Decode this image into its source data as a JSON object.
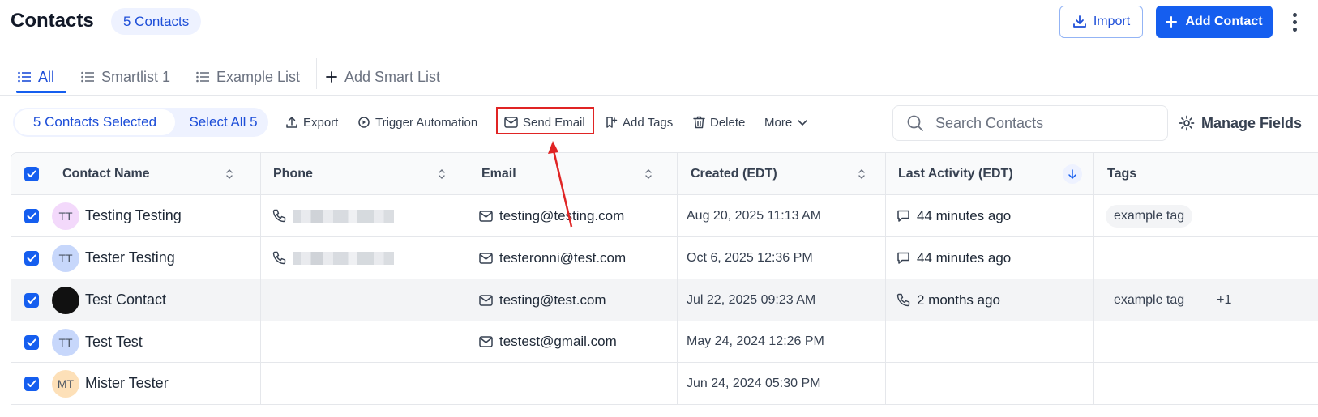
{
  "header": {
    "title": "Contacts",
    "count_pill": "5 Contacts",
    "import_label": "Import",
    "add_contact_label": "Add Contact"
  },
  "tabs": [
    {
      "label": "All",
      "active": true
    },
    {
      "label": "Smartlist 1",
      "active": false
    },
    {
      "label": "Example List",
      "active": false
    },
    {
      "label": "Add Smart List",
      "active": false
    }
  ],
  "toolbar": {
    "selected_label": "5 Contacts Selected",
    "select_all_label": "Select All 5",
    "export_label": "Export",
    "trigger_label": "Trigger Automation",
    "send_email_label": "Send Email",
    "add_tags_label": "Add Tags",
    "delete_label": "Delete",
    "more_label": "More",
    "search_placeholder": "Search Contacts",
    "manage_fields_label": "Manage Fields"
  },
  "table": {
    "columns": [
      "Contact Name",
      "Phone",
      "Email",
      "Created (EDT)",
      "Last Activity (EDT)",
      "Tags"
    ],
    "rows": [
      {
        "initials": "TT",
        "avatar_color": "#f3d9fb",
        "name": "Testing Testing",
        "phone_redacted": true,
        "email": "testing@testing.com",
        "created": "Aug 20, 2025 11:13 AM",
        "activity_icon": "chat-icon",
        "activity": "44 minutes ago",
        "tag": "example tag",
        "extra_tags": ""
      },
      {
        "initials": "TT",
        "avatar_color": "#c7d7fb",
        "name": "Tester Testing",
        "phone_redacted": true,
        "email": "testeronni@test.com",
        "created": "Oct 6, 2025 12:36 PM",
        "activity_icon": "chat-icon",
        "activity": "44 minutes ago",
        "tag": "",
        "extra_tags": ""
      },
      {
        "initials": "",
        "avatar_color": "#111111",
        "name": "Test Contact",
        "phone_redacted": false,
        "email": "testing@test.com",
        "created": "Jul 22, 2025 09:23 AM",
        "activity_icon": "phone-icon",
        "activity": "2 months ago",
        "tag": "example tag",
        "extra_tags": "+1"
      },
      {
        "initials": "TT",
        "avatar_color": "#c7d7fb",
        "name": "Test Test",
        "phone_redacted": false,
        "email": "testest@gmail.com",
        "created": "May 24, 2024 12:26 PM",
        "activity_icon": "",
        "activity": "",
        "tag": "",
        "extra_tags": ""
      },
      {
        "initials": "MT",
        "avatar_color": "#fde0b8",
        "name": "Mister Tester",
        "phone_redacted": false,
        "email": "",
        "created": "Jun 24, 2024 05:30 PM",
        "activity_icon": "",
        "activity": "",
        "tag": "",
        "extra_tags": ""
      }
    ]
  },
  "colors": {
    "accent": "#155eef",
    "highlight_box": "#e02424"
  }
}
